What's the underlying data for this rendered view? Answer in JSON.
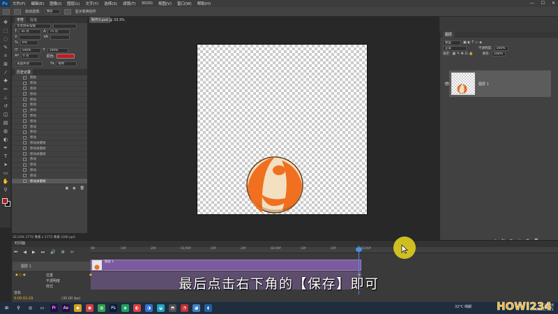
{
  "menu": {
    "logo": "Ps",
    "items": [
      "文件(F)",
      "编辑(E)",
      "图像(I)",
      "图层(L)",
      "文字(Y)",
      "选择(S)",
      "滤镜(T)",
      "3D(D)",
      "视图(V)",
      "窗口(W)",
      "帮助(H)"
    ],
    "window_controls": [
      "—",
      "☐",
      "✕"
    ]
  },
  "options_bar": {
    "items": [
      "自动选择:",
      "图层",
      "显示变换控件"
    ]
  },
  "character_panel": {
    "tabs": [
      "字符",
      "段落"
    ],
    "font_family": "华文仿宋常规",
    "font_size": "35 点",
    "leading": "75 点",
    "tracking": "0%",
    "vertical_scale": "100%",
    "horizontal_scale": "100%",
    "baseline": "0 点",
    "color_label": "颜色:",
    "language": "美国英语",
    "antialias": "锐利",
    "color_hex": "#c21b1b"
  },
  "history_panel": {
    "title": "历史记录",
    "items": [
      "粘贴",
      "移动",
      "移动",
      "移动",
      "移动",
      "移动",
      "移动",
      "移动",
      "移动",
      "移动",
      "移动",
      "移动",
      "移动关键帧",
      "移动关键帧",
      "移动关键帧",
      "移动",
      "移动",
      "移动",
      "移动",
      "移动关键帧"
    ]
  },
  "document": {
    "tab_label": "制作3.psd @ 33.3%",
    "status": "33.33%   1772 像素 x 1772 像素 (100 ppi)"
  },
  "layers_panel": {
    "tabs": [
      "图层"
    ],
    "filter_label": "类型",
    "blend_mode": "正常",
    "opacity_label": "不透明度:",
    "opacity_value": "100%",
    "lock_label": "锁定:",
    "fill_label": "填充:",
    "fill_value": "100%",
    "layer_name": "图层 1",
    "footer_icons": [
      "fx",
      "◐",
      "▢",
      "▣",
      "🗑"
    ]
  },
  "timeline": {
    "title": "时间轴",
    "timecode": "0:00:02:29",
    "fps": "(30.00 fps)",
    "ruler_ticks": [
      "00",
      "10f",
      "20f",
      "01:00f",
      "10f",
      "20f",
      "02:00f",
      "10f",
      "20f",
      "03:00f"
    ],
    "layer_track": "图层 1",
    "properties": [
      "位置",
      "不透明度",
      "样式"
    ],
    "audio_track": "音轨",
    "clip_label": "图层 1"
  },
  "subtitle": "最后点击右下角的【保存】即可",
  "watermark": "HOWI234",
  "taskbar": {
    "apps": [
      "⊞",
      "⚲",
      "◎",
      "▭",
      "Pr",
      "Ae",
      "◆",
      "◉",
      "◍",
      "Ps",
      "◈",
      "◐",
      "◑",
      "◒",
      "◓",
      "◔",
      "◕",
      "◖"
    ],
    "weather": "32°C 晴朗",
    "time": "11:38",
    "date": "2021/7/21"
  },
  "colors": {
    "ball_orange": "#f07020",
    "ball_cream": "#f2e0c0",
    "highlight": "#ebd71e",
    "ps_blue": "#31a8ff"
  }
}
